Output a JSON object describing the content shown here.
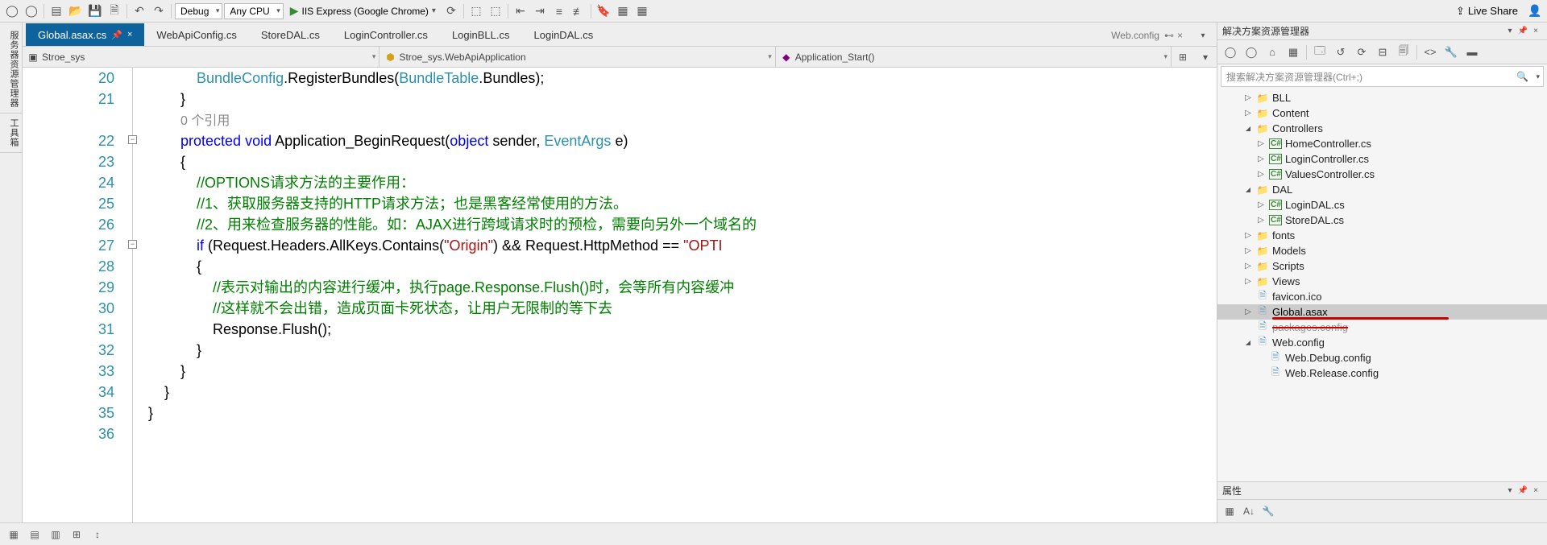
{
  "toolbar": {
    "config_debug": "Debug",
    "config_platform": "Any CPU",
    "run_target": "IIS Express (Google Chrome)",
    "live_share": "Live Share"
  },
  "tabs": {
    "items": [
      {
        "label": "Global.asax.cs",
        "active": true,
        "pinned": true
      },
      {
        "label": "WebApiConfig.cs"
      },
      {
        "label": "StoreDAL.cs"
      },
      {
        "label": "LoginController.cs"
      },
      {
        "label": "LoginBLL.cs"
      },
      {
        "label": "LoginDAL.cs"
      }
    ],
    "overflow": "Web.config"
  },
  "nav": {
    "scope": "Stroe_sys",
    "class": "Stroe_sys.WebApiApplication",
    "member": "Application_Start()"
  },
  "side_tabs": {
    "a": "服务器资源管理器",
    "b": "工具箱"
  },
  "code": {
    "lines": [
      {
        "n": 20,
        "html": "            <span class='type'>BundleConfig</span>.<span class='ident'>RegisterBundles</span>(<span class='type'>BundleTable</span>.<span class='ident'>Bundles</span>);"
      },
      {
        "n": 21,
        "html": "        }"
      },
      {
        "n": "",
        "html": "        <span class='ref'>0 个引用</span>"
      },
      {
        "n": 22,
        "html": "        <span class='kw'>protected</span> <span class='kw'>void</span> <span class='ident'>Application_BeginRequest</span>(<span class='kw'>object</span> sender, <span class='type'>EventArgs</span> e)"
      },
      {
        "n": 23,
        "html": "        {"
      },
      {
        "n": 24,
        "html": "            <span class='cmt'>//OPTIONS请求方法的主要作用：</span>"
      },
      {
        "n": 25,
        "html": "            <span class='cmt'>//1、获取服务器支持的HTTP请求方法；也是黑客经常使用的方法。</span>"
      },
      {
        "n": 26,
        "html": "            <span class='cmt'>//2、用来检查服务器的性能。如：AJAX进行跨域请求时的预检，需要向另外一个域名的</span>"
      },
      {
        "n": 27,
        "html": "            <span class='kw'>if</span> (Request.Headers.AllKeys.<span class='ident'>Contains</span>(<span class='str'>\"Origin\"</span>) && Request.HttpMethod == <span class='str'>\"OPTI</span>"
      },
      {
        "n": 28,
        "html": "            {"
      },
      {
        "n": 29,
        "html": "                <span class='cmt'>//表示对输出的内容进行缓冲，执行page.Response.Flush()时，会等所有内容缓冲</span>"
      },
      {
        "n": 30,
        "html": "                <span class='cmt'>//这样就不会出错，造成页面卡死状态，让用户无限制的等下去</span>"
      },
      {
        "n": 31,
        "html": "                Response.<span class='ident'>Flush</span>();"
      },
      {
        "n": 32,
        "html": "            }"
      },
      {
        "n": 33,
        "html": "        }"
      },
      {
        "n": 34,
        "html": "    }"
      },
      {
        "n": 35,
        "html": "}"
      },
      {
        "n": 36,
        "html": ""
      }
    ]
  },
  "solution": {
    "title": "解决方案资源管理器",
    "search_placeholder": "搜索解决方案资源管理器(Ctrl+;)",
    "tree": [
      {
        "indent": 2,
        "arrow": "closed",
        "icon": "folder",
        "label": "BLL"
      },
      {
        "indent": 2,
        "arrow": "closed",
        "icon": "folder",
        "label": "Content"
      },
      {
        "indent": 2,
        "arrow": "open",
        "icon": "folder",
        "label": "Controllers"
      },
      {
        "indent": 3,
        "arrow": "closed",
        "icon": "cs",
        "label": "HomeController.cs"
      },
      {
        "indent": 3,
        "arrow": "closed",
        "icon": "cs",
        "label": "LoginController.cs"
      },
      {
        "indent": 3,
        "arrow": "closed",
        "icon": "cs",
        "label": "ValuesController.cs"
      },
      {
        "indent": 2,
        "arrow": "open",
        "icon": "folder",
        "label": "DAL"
      },
      {
        "indent": 3,
        "arrow": "closed",
        "icon": "cs",
        "label": "LoginDAL.cs"
      },
      {
        "indent": 3,
        "arrow": "closed",
        "icon": "cs",
        "label": "StoreDAL.cs"
      },
      {
        "indent": 2,
        "arrow": "closed",
        "icon": "folder",
        "label": "fonts"
      },
      {
        "indent": 2,
        "arrow": "closed",
        "icon": "folder",
        "label": "Models"
      },
      {
        "indent": 2,
        "arrow": "closed",
        "icon": "folder",
        "label": "Scripts"
      },
      {
        "indent": 2,
        "arrow": "closed",
        "icon": "folder",
        "label": "Views"
      },
      {
        "indent": 2,
        "arrow": "none",
        "icon": "file",
        "label": "favicon.ico"
      },
      {
        "indent": 2,
        "arrow": "closed",
        "icon": "file",
        "label": "Global.asax",
        "selected": true,
        "redline": true
      },
      {
        "indent": 2,
        "arrow": "none",
        "icon": "file",
        "label": "packages.config",
        "strike": true
      },
      {
        "indent": 2,
        "arrow": "open",
        "icon": "file",
        "label": "Web.config"
      },
      {
        "indent": 3,
        "arrow": "none",
        "icon": "file",
        "label": "Web.Debug.config"
      },
      {
        "indent": 3,
        "arrow": "none",
        "icon": "file",
        "label": "Web.Release.config"
      }
    ]
  },
  "properties": {
    "title": "属性"
  }
}
